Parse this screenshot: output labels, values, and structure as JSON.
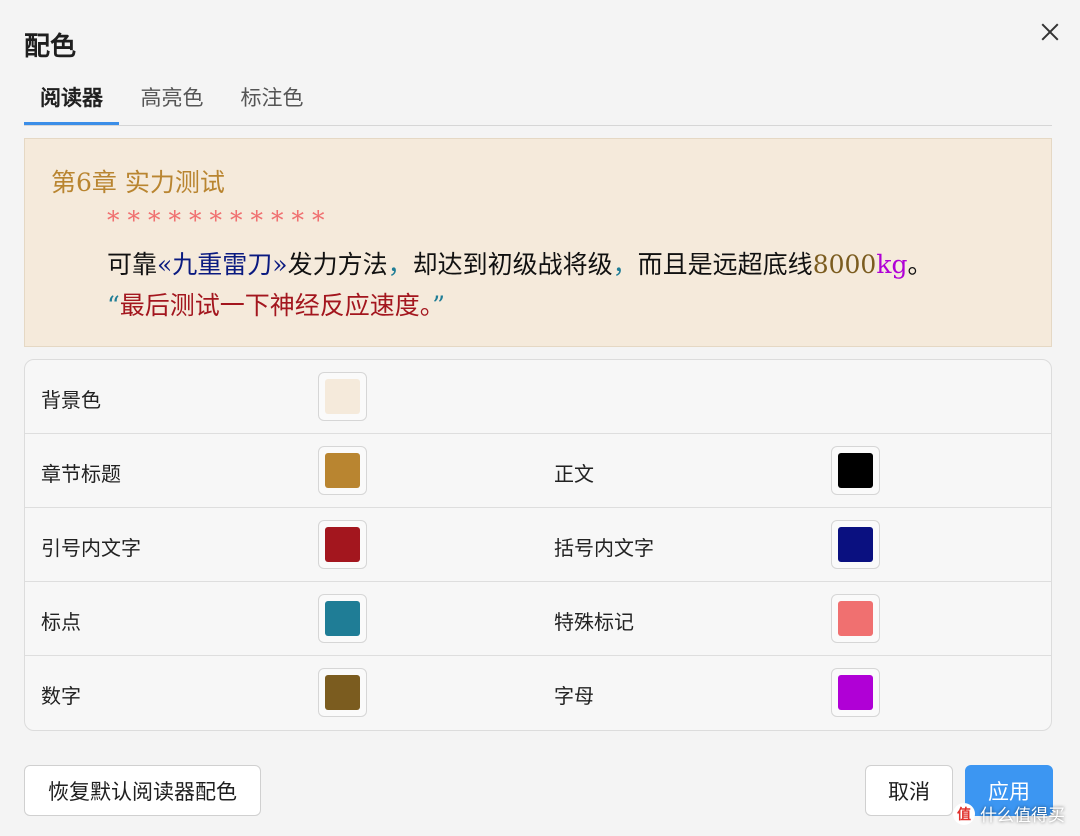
{
  "dialog": {
    "title": "配色"
  },
  "tabs": [
    {
      "label": "阅读器",
      "active": true
    },
    {
      "label": "高亮色",
      "active": false
    },
    {
      "label": "标注色",
      "active": false
    }
  ],
  "preview": {
    "chapter_title": "第6章  实力测试",
    "stars": "***********",
    "line": {
      "part1": "可靠",
      "bracket": "«九重雷刀»",
      "part2": "发力方法",
      "punct1": "，",
      "part3": "却达到初级战将级",
      "punct2": "，",
      "part4": "而且是远超底线",
      "number": "8000",
      "letters": "kg",
      "end": "。"
    },
    "quote": {
      "open": "“",
      "text": "最后测试一下神经反应速度。",
      "close": "”"
    }
  },
  "color_settings": [
    {
      "label": "背景色",
      "color": "#f5eadb"
    },
    {
      "label": "章节标题",
      "color": "#b98530"
    },
    {
      "label": "正文",
      "color": "#000000"
    },
    {
      "label": "引号内文字",
      "color": "#a3161e"
    },
    {
      "label": "括号内文字",
      "color": "#0a1080"
    },
    {
      "label": "标点",
      "color": "#1f7d96"
    },
    {
      "label": "特殊标记",
      "color": "#f07070"
    },
    {
      "label": "数字",
      "color": "#7b5c1f"
    },
    {
      "label": "字母",
      "color": "#b000d6"
    }
  ],
  "buttons": {
    "reset": "恢复默认阅读器配色",
    "cancel": "取消",
    "apply": "应用"
  },
  "watermark": {
    "badge": "值",
    "text": "什么值得买"
  }
}
